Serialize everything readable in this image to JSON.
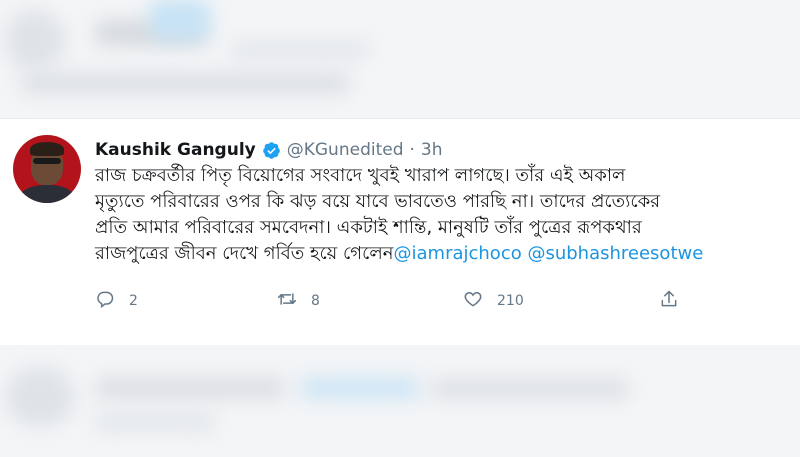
{
  "tweet": {
    "author_name": "Kaushik Ganguly",
    "author_handle": "@KGunedited",
    "separator": "·",
    "timestamp": "3h",
    "text_lines": [
      "রাজ চক্রবর্তীর পিতৃ বিয়োগের সংবাদে খুবই খারাপ লাগছে। তাঁর এই অকাল",
      "মৃত্যুতে পরিবারের ওপর কি ঝড় বয়ে যাবে ভাবতেও পারছি না। তাদের প্রত্যেকের",
      "প্রতি আমার পরিবারের সমবেদনা। একটাই শান্তি, মানুষটি তাঁর পুত্রের রূপকথার"
    ],
    "last_line_text": "রাজপুত্রের জীবন দেখে গর্বিত হয়ে গেলেন",
    "mentions": [
      "@iamrajchoco",
      "@subhashreesotwe"
    ],
    "reply_count": "2",
    "retweet_count": "8",
    "like_count": "210"
  },
  "icons": {
    "avatar": "profile-photo",
    "verified": "verified-badge-icon",
    "reply": "reply-icon",
    "retweet": "retweet-icon",
    "like": "heart-icon",
    "share": "share-icon"
  },
  "colors": {
    "accent": "#1da1f2",
    "mention": "#1b95e0",
    "text": "#14171a",
    "muted": "#657786"
  }
}
